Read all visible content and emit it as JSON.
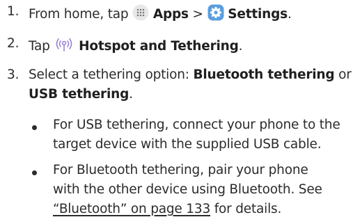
{
  "steps": [
    {
      "number": "1.",
      "prefix": "From home, tap",
      "apps_label": "Apps",
      "separator": ">",
      "settings_label": "Settings",
      "suffix": "."
    },
    {
      "number": "2.",
      "prefix": "Tap",
      "hotspot_label": "Hotspot and Tethering",
      "suffix": "."
    },
    {
      "number": "3.",
      "prefix": "Select a tethering option:",
      "bluetooth_option": "Bluetooth tethering",
      "or_text": "or",
      "usb_option": "USB tethering",
      "suffix": "."
    }
  ],
  "bullets": [
    {
      "line1": "For USB tethering, connect your phone to the",
      "line2": "target device with the supplied USB cable."
    },
    {
      "line1": "For Bluetooth tethering, pair your phone",
      "line2": "with the other device using Bluetooth. See",
      "link_text": "“Bluetooth” on page 133",
      "line3_suffix": "for details."
    }
  ],
  "icons": {
    "apps": "apps-grid-icon",
    "settings": "settings-gear-icon",
    "hotspot": "hotspot-icon",
    "apps_icon_color": "#e8e8e8",
    "settings_icon_color": "#5a9fe0",
    "hotspot_icon_color": "#9b7fd6"
  }
}
